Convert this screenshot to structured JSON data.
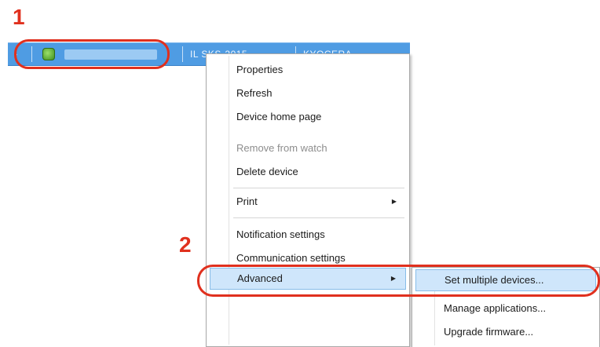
{
  "callouts": {
    "step1": "1",
    "step2": "2"
  },
  "device_bar": {
    "expand_glyph": "›",
    "col2_text": "IL SKS-2015",
    "col3_text": "KYOCERA"
  },
  "context_menu": {
    "items": [
      {
        "label": "Properties"
      },
      {
        "label": "Refresh"
      },
      {
        "label": "Device home page"
      },
      {
        "label": "Remove from watch"
      },
      {
        "label": "Delete device"
      },
      {
        "label": "Print"
      },
      {
        "label": "Notification settings"
      },
      {
        "label": "Communication settings"
      },
      {
        "label": "Advanced"
      }
    ]
  },
  "submenu": {
    "items": [
      {
        "label": "Set multiple devices..."
      },
      {
        "label": "Manage applications..."
      },
      {
        "label": "Upgrade firmware..."
      }
    ]
  },
  "colors": {
    "callout_red": "#e0301e",
    "device_bar_blue": "#4f9ce3",
    "menu_highlight": "#cfe6fb"
  },
  "icons": {
    "expand": "chevron-right-icon",
    "device": "device-status-icon",
    "submenu": "submenu-arrow-icon"
  }
}
